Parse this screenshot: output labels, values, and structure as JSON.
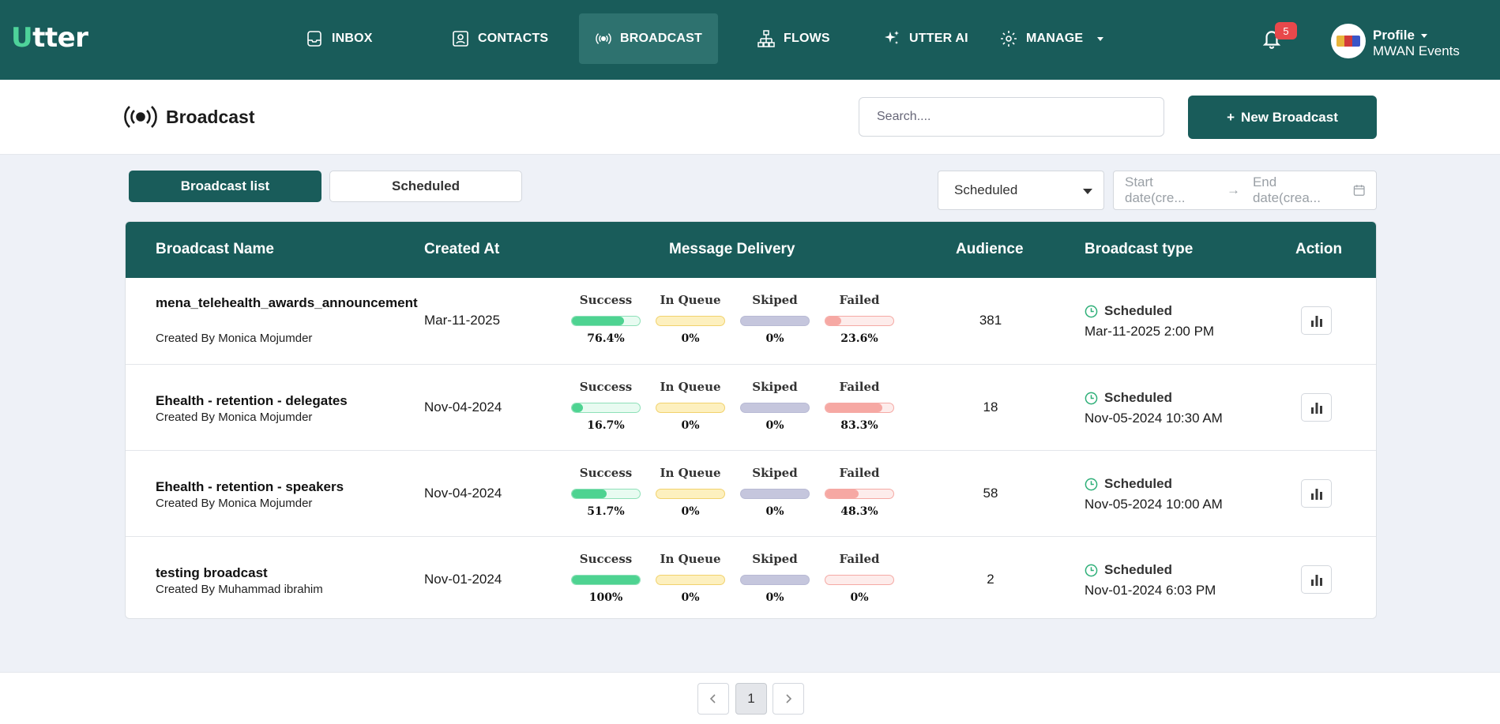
{
  "app": {
    "logo_u": "U",
    "logo_rest": "tter"
  },
  "nav": {
    "inbox": "INBOX",
    "contacts": "CONTACTS",
    "broadcast": "BROADCAST",
    "flows": "FLOWS",
    "utter_ai": "UTTER AI",
    "manage": "MANAGE"
  },
  "notifications": {
    "count": "5"
  },
  "profile": {
    "label": "Profile",
    "org": "MWAN Events"
  },
  "header": {
    "title": "Broadcast",
    "search_placeholder": "Search....",
    "new_button": "New Broadcast",
    "new_button_icon": "+"
  },
  "tabs": {
    "list": "Broadcast list",
    "scheduled": "Scheduled"
  },
  "filters": {
    "status_selected": "Scheduled",
    "start_placeholder": "Start date(cre...",
    "end_placeholder": "End date(crea...",
    "arrow": "→"
  },
  "table": {
    "headers": {
      "name": "Broadcast Name",
      "created": "Created At",
      "delivery": "Message Delivery",
      "audience": "Audience",
      "type": "Broadcast type",
      "action": "Action"
    },
    "metric_labels": {
      "success": "Success",
      "queue": "In Queue",
      "skip": "Skiped",
      "failed": "Failed"
    },
    "rows": [
      {
        "name": "mena_telehealth_awards_announcement",
        "by": "Created By Monica Mojumder",
        "created": "Mar-11-2025",
        "success": "76.4%",
        "queue": "0%",
        "skip": "0%",
        "failed": "23.6%",
        "success_pct": 76.4,
        "failed_pct": 23.6,
        "audience": "381",
        "type": "Scheduled",
        "schedule": "Mar-11-2025 2:00 PM"
      },
      {
        "name": "Ehealth - retention - delegates",
        "by": "Created By Monica Mojumder",
        "created": "Nov-04-2024",
        "success": "16.7%",
        "queue": "0%",
        "skip": "0%",
        "failed": "83.3%",
        "success_pct": 16.7,
        "failed_pct": 83.3,
        "audience": "18",
        "type": "Scheduled",
        "schedule": "Nov-05-2024 10:30 AM"
      },
      {
        "name": "Ehealth - retention - speakers",
        "by": "Created By Monica Mojumder",
        "created": "Nov-04-2024",
        "success": "51.7%",
        "queue": "0%",
        "skip": "0%",
        "failed": "48.3%",
        "success_pct": 51.7,
        "failed_pct": 48.3,
        "audience": "58",
        "type": "Scheduled",
        "schedule": "Nov-05-2024 10:00 AM"
      },
      {
        "name": "testing broadcast",
        "by": "Created By Muhammad ibrahim",
        "created": "Nov-01-2024",
        "success": "100%",
        "queue": "0%",
        "skip": "0%",
        "failed": "0%",
        "success_pct": 100,
        "failed_pct": 0,
        "audience": "2",
        "type": "Scheduled",
        "schedule": "Nov-01-2024 6:03 PM"
      }
    ]
  },
  "pagination": {
    "current": "1"
  },
  "colors": {
    "brand": "#195c5a",
    "accent": "#4ed39a",
    "success": "#4ed391",
    "failed": "#f6a8a3",
    "badge": "#e8484b"
  },
  "icons": {
    "inbox": "inbox-icon",
    "contacts": "contacts-icon",
    "broadcast": "broadcast-icon",
    "flows": "flows-icon",
    "ai": "sparkle-icon",
    "manage": "gear-icon",
    "bell": "bell-icon",
    "clock": "clock-icon",
    "stats": "bar-chart-icon",
    "prev": "chevron-left-icon",
    "next": "chevron-right-icon",
    "calendar": "calendar-icon"
  }
}
